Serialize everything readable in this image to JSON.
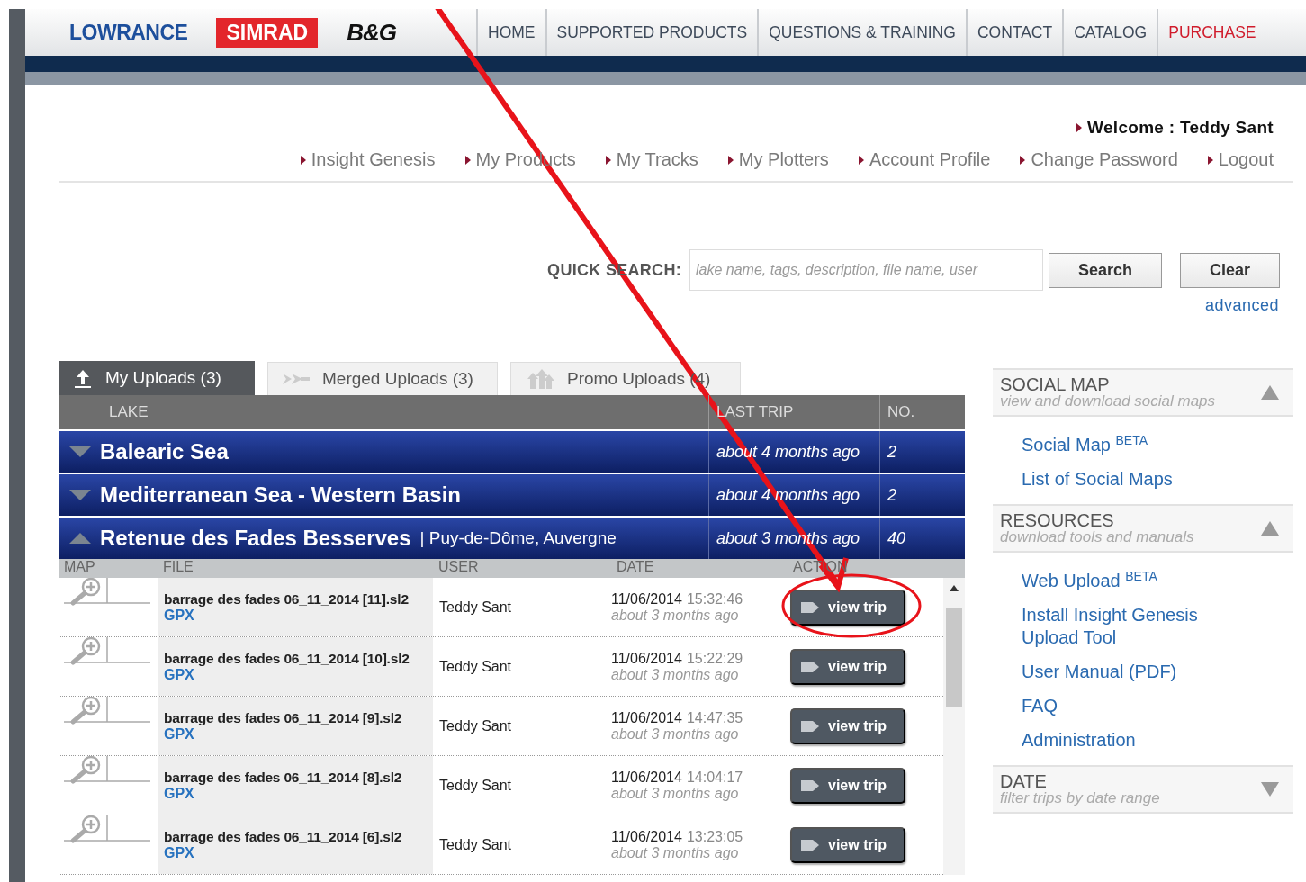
{
  "header": {
    "logos": [
      {
        "text": "LOWRANCE",
        "kind": "lowrance"
      },
      {
        "text": "SIMRAD",
        "kind": "simrad"
      },
      {
        "text": "B&G",
        "kind": "bg"
      }
    ],
    "nav": [
      {
        "label": "HOME",
        "highlighted": false
      },
      {
        "label": "SUPPORTED PRODUCTS",
        "highlighted": false
      },
      {
        "label": "QUESTIONS & TRAINING",
        "highlighted": false
      },
      {
        "label": "CONTACT",
        "highlighted": false
      },
      {
        "label": "CATALOG",
        "highlighted": false
      },
      {
        "label": "PURCHASE",
        "highlighted": true
      }
    ]
  },
  "welcome": "Welcome : Teddy Sant",
  "user_links": [
    "Insight Genesis",
    "My Products",
    "My Tracks",
    "My Plotters",
    "Account Profile",
    "Change Password",
    "Logout"
  ],
  "quick_search": {
    "label": "QUICK SEARCH:",
    "placeholder": "lake name, tags, description, file name, user",
    "buttons": [
      "Search",
      "Clear"
    ],
    "advanced": "advanced"
  },
  "tabs": [
    {
      "label": "My Uploads (3)",
      "kind": "upload",
      "selected": true
    },
    {
      "label": "Merged Uploads (3)",
      "kind": "merged",
      "selected": false
    },
    {
      "label": "Promo Uploads (4)",
      "kind": "promo",
      "selected": false
    }
  ],
  "lakes_table": {
    "columns": [
      "LAKE",
      "LAST TRIP",
      "NO."
    ],
    "lakes": [
      {
        "name": "Balearic Sea",
        "last_trip": "about 4 months ago",
        "count": "2",
        "expanded": false
      },
      {
        "name": "Mediterranean Sea - Western Basin",
        "last_trip": "about 4 months ago",
        "count": "2",
        "expanded": false
      },
      {
        "name": "Retenue des Fades Besserves",
        "region": "| Puy-de-Dôme, Auvergne",
        "last_trip": "about 3 months ago",
        "count": "40",
        "expanded": true
      }
    ]
  },
  "trips": {
    "columns": [
      "MAP",
      "FILE",
      "USER",
      "DATE",
      "ACTION"
    ],
    "rows": [
      {
        "file": "barrage des fades 06_11_2014 [11].sl2",
        "format": "GPX",
        "user": "Teddy Sant",
        "date": "11/06/2014",
        "time": "15:32:46",
        "ago": "about 3 months ago",
        "action": "view trip"
      },
      {
        "file": "barrage des fades 06_11_2014 [10].sl2",
        "format": "GPX",
        "user": "Teddy Sant",
        "date": "11/06/2014",
        "time": "15:22:29",
        "ago": "about 3 months ago",
        "action": "view trip"
      },
      {
        "file": "barrage des fades 06_11_2014 [9].sl2",
        "format": "GPX",
        "user": "Teddy Sant",
        "date": "11/06/2014",
        "time": "14:47:35",
        "ago": "about 3 months ago",
        "action": "view trip"
      },
      {
        "file": "barrage des fades 06_11_2014 [8].sl2",
        "format": "GPX",
        "user": "Teddy Sant",
        "date": "11/06/2014",
        "time": "14:04:17",
        "ago": "about 3 months ago",
        "action": "view trip"
      },
      {
        "file": "barrage des fades 06_11_2014 [6].sl2",
        "format": "GPX",
        "user": "Teddy Sant",
        "date": "11/06/2014",
        "time": "13:23:05",
        "ago": "about 3 months ago",
        "action": "view trip"
      }
    ]
  },
  "sidebar": [
    {
      "title": "SOCIAL MAP",
      "subtitle": "view and download social maps",
      "expanded": true,
      "links": [
        "Social Map $^{BETA}$",
        "List of Social Maps"
      ]
    },
    {
      "title": "RESOURCES",
      "subtitle": "download tools and manuals",
      "expanded": true,
      "links": [
        "Web Upload $^{BETA}$",
        "Install Insight Genesis Upload Tool",
        "User Manual (PDF)",
        "FAQ",
        "Administration"
      ]
    },
    {
      "title": "DATE",
      "subtitle": "filter trips by date range",
      "expanded": false
    }
  ]
}
